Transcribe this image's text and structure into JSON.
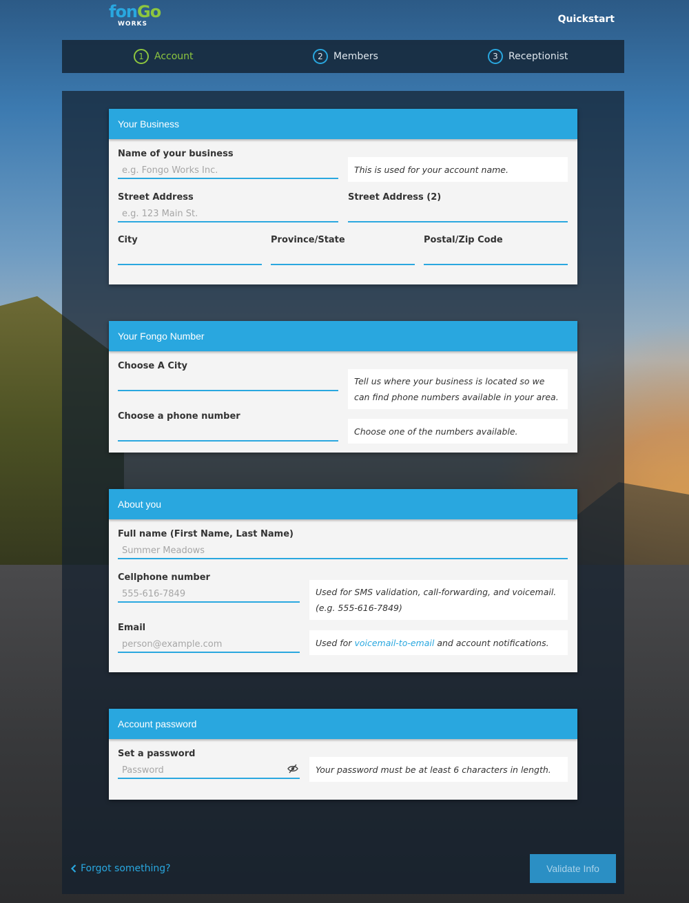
{
  "header": {
    "logo_text_1": "fon",
    "logo_text_2": "Go",
    "logo_sub": "WORKS",
    "quickstart_label": "Quickstart"
  },
  "steps": [
    {
      "number": "1",
      "label": "Account",
      "state": "active"
    },
    {
      "number": "2",
      "label": "Members",
      "state": "inactive"
    },
    {
      "number": "3",
      "label": "Receptionist",
      "state": "inactive"
    }
  ],
  "business": {
    "title": "Your Business",
    "name_label": "Name of your business",
    "name_placeholder": "e.g. Fongo Works Inc.",
    "name_hint": "This is used for your account name.",
    "street_label": "Street Address",
    "street_placeholder": "e.g. 123 Main St.",
    "street2_label": "Street Address (2)",
    "city_label": "City",
    "province_label": "Province/State",
    "postal_label": "Postal/Zip Code"
  },
  "fongo_number": {
    "title": "Your Fongo Number",
    "city_label": "Choose A City",
    "city_hint": "Tell us where your business is located so we can find phone numbers available in your area.",
    "phone_label": "Choose a phone number",
    "phone_hint": "Choose one of the numbers available."
  },
  "about": {
    "title": "About you",
    "fullname_label": "Full name (First Name, Last Name)",
    "fullname_placeholder": "Summer Meadows",
    "cell_label": "Cellphone number",
    "cell_placeholder": "555-616-7849",
    "cell_hint_line1": "Used for SMS validation, call-forwarding, and voicemail.",
    "cell_hint_line2": "(e.g. 555-616-7849)",
    "email_label": "Email",
    "email_placeholder": "person@example.com",
    "email_hint_pre": "Used for ",
    "email_hint_link": "voicemail-to-email",
    "email_hint_post": " and account notifications."
  },
  "password": {
    "title": "Account password",
    "label": "Set a password",
    "placeholder": "Password",
    "hint": "Your password must be at least 6 characters in length.",
    "toggle_icon": "eye-slash-icon"
  },
  "footer": {
    "forgot_label": "Forgot something?",
    "validate_label": "Validate Info"
  },
  "colors": {
    "accent": "#29a7df",
    "active_step": "#8dc63f",
    "card_bg": "#f4f4f4"
  }
}
